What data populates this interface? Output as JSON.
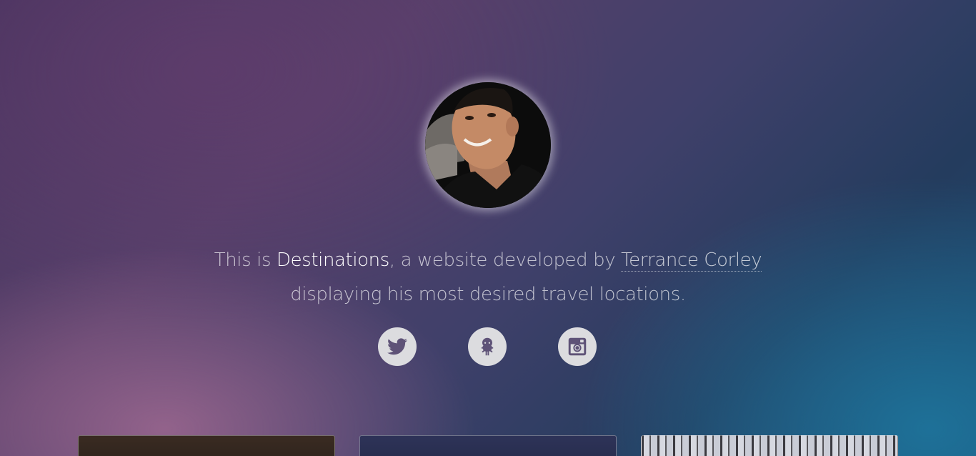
{
  "profile": {
    "avatar_alt": "Terrance Corley"
  },
  "intro": {
    "prefix": "This is ",
    "site_name": "Destinations",
    "middle": ", a website developed by ",
    "author_name": "Terrance Corley",
    "line2": "displaying his most desired travel locations."
  },
  "social": [
    {
      "icon": "twitter-icon"
    },
    {
      "icon": "github-icon"
    },
    {
      "icon": "instagram-icon"
    }
  ],
  "colors": {
    "social_bg": "#dcdcdf",
    "social_icon": "#5e5277",
    "highlight_text": "#ffffff"
  }
}
